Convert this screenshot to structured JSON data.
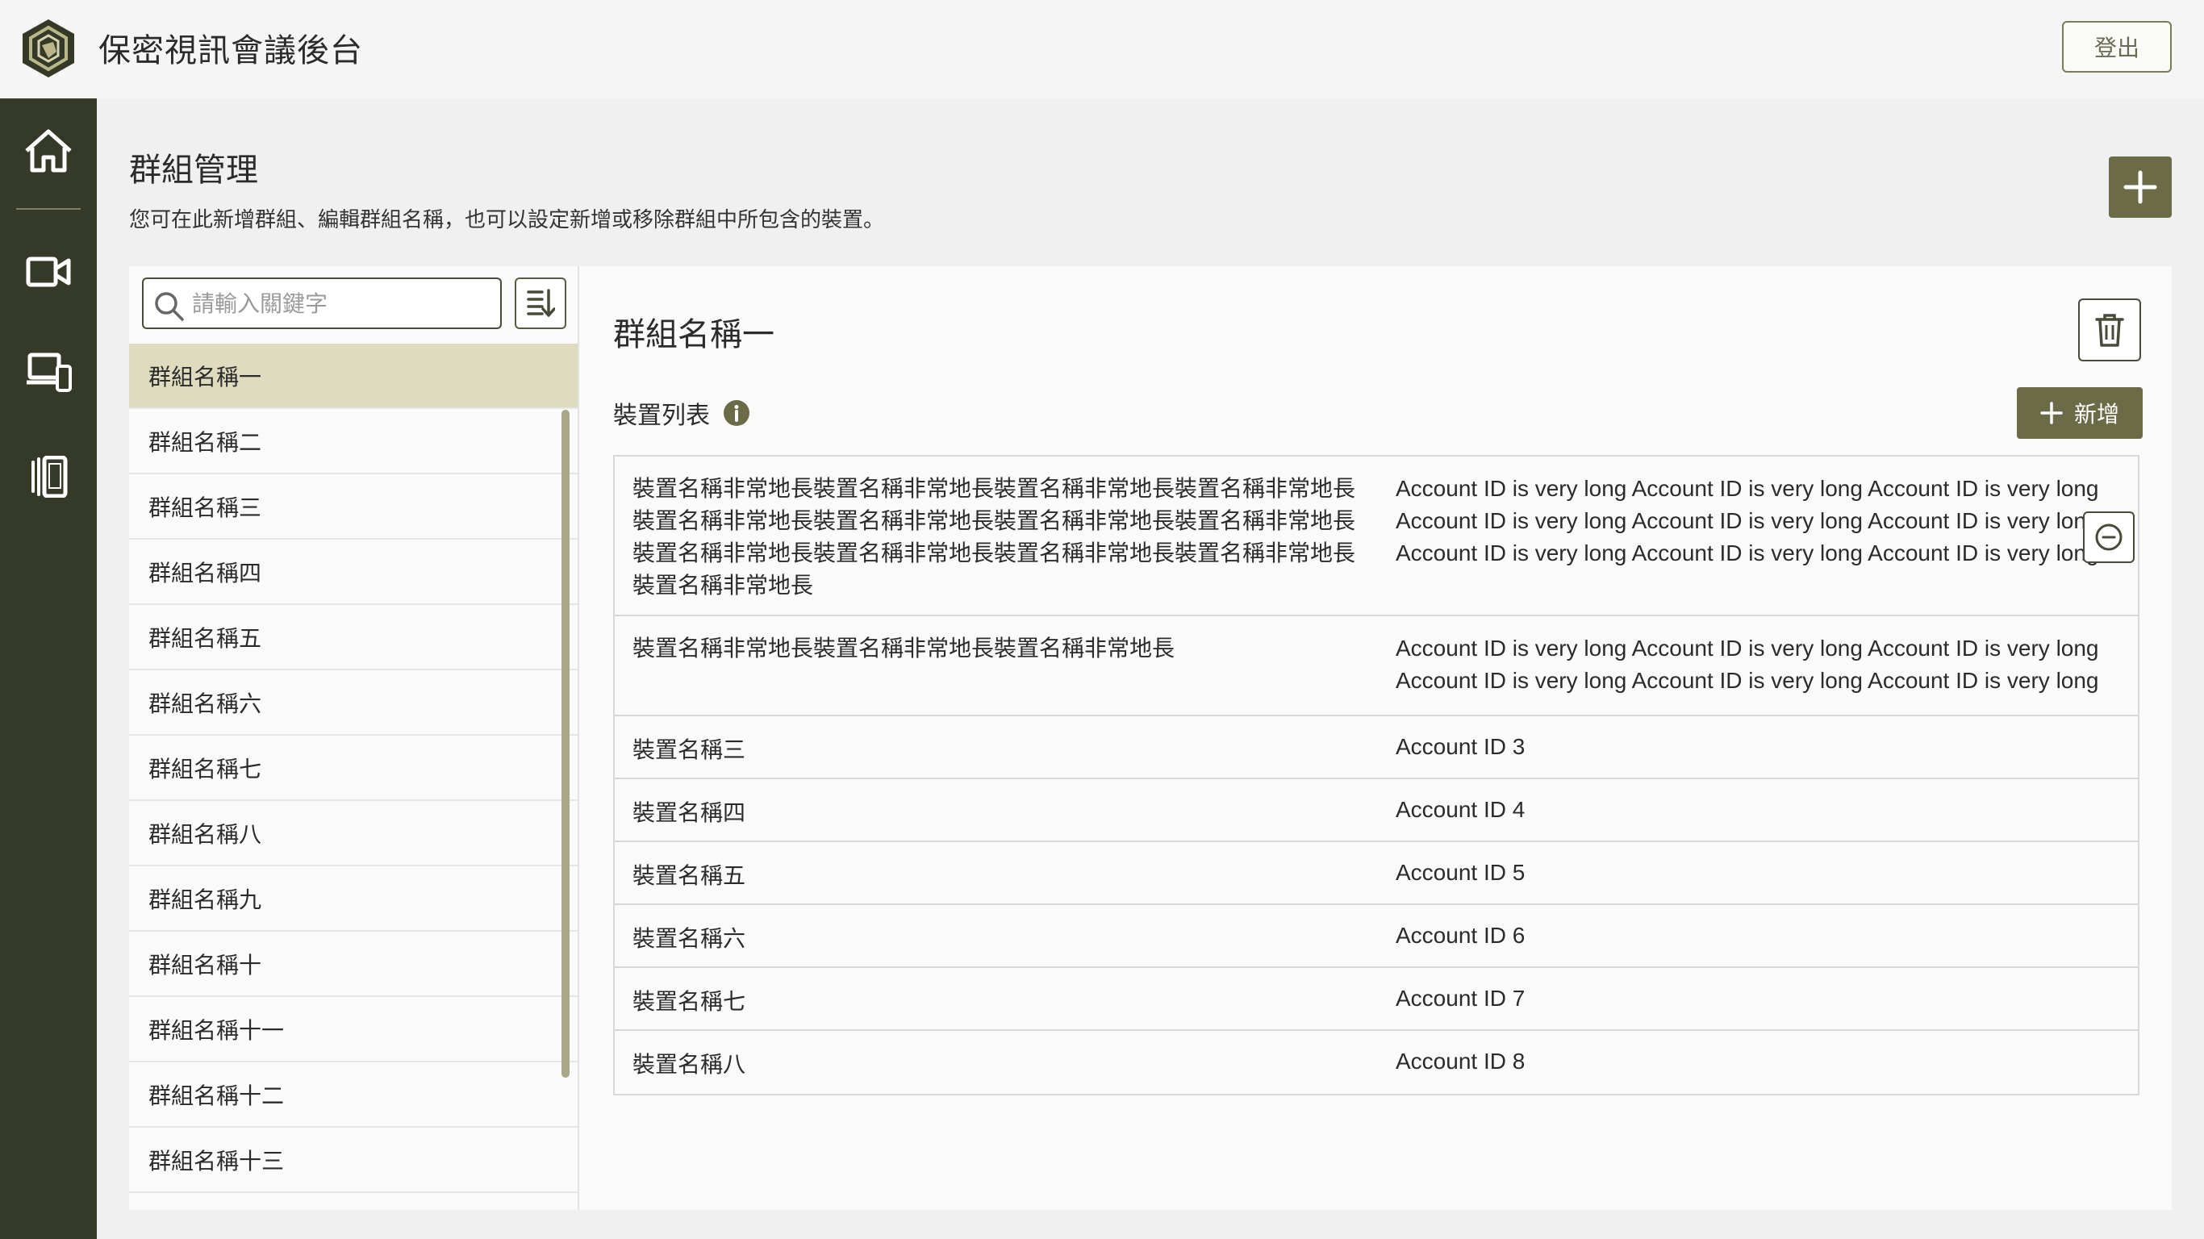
{
  "header": {
    "app_title": "保密視訊會議後台",
    "logout_label": "登出"
  },
  "sidebar": {
    "items": [
      {
        "icon": "home-icon"
      },
      {
        "icon": "video-camera-icon"
      },
      {
        "icon": "devices-icon"
      },
      {
        "icon": "mobile-devices-icon"
      }
    ]
  },
  "page": {
    "title": "群組管理",
    "description": "您可在此新增群組、編輯群組名稱，也可以設定新增或移除群組中所包含的裝置。"
  },
  "search": {
    "placeholder": "請輸入關鍵字",
    "value": ""
  },
  "groups": [
    "群組名稱一",
    "群組名稱二",
    "群組名稱三",
    "群組名稱四",
    "群組名稱五",
    "群組名稱六",
    "群組名稱七",
    "群組名稱八",
    "群組名稱九",
    "群組名稱十",
    "群組名稱十一",
    "群組名稱十二",
    "群組名稱十三"
  ],
  "selected_group_index": 0,
  "detail": {
    "title": "群組名稱一",
    "device_list_label": "裝置列表",
    "add_label": "新增"
  },
  "devices": [
    {
      "name": "裝置名稱非常地長裝置名稱非常地長裝置名稱非常地長裝置名稱非常地長裝置名稱非常地長裝置名稱非常地長裝置名稱非常地長裝置名稱非常地長裝置名稱非常地長裝置名稱非常地長裝置名稱非常地長裝置名稱非常地長裝置名稱非常地長",
      "account": "Account ID is very long Account ID is very long Account ID is very long Account ID is very long Account ID is very long Account ID is very long Account ID is very long Account ID is very long Account ID is very long"
    },
    {
      "name": "裝置名稱非常地長裝置名稱非常地長裝置名稱非常地長",
      "account": "Account ID is very long Account ID is very long Account ID is very long Account ID is very long Account ID is very long Account ID is very long"
    },
    {
      "name": "裝置名稱三",
      "account": "Account ID 3"
    },
    {
      "name": "裝置名稱四",
      "account": "Account ID 4"
    },
    {
      "name": "裝置名稱五",
      "account": "Account ID 5"
    },
    {
      "name": "裝置名稱六",
      "account": "Account ID 6"
    },
    {
      "name": "裝置名稱七",
      "account": "Account ID 7"
    },
    {
      "name": "裝置名稱八",
      "account": "Account ID 8"
    }
  ],
  "colors": {
    "brand": "#6b6b48",
    "sidebar": "#353a28",
    "selected_row": "#dedbbf"
  }
}
